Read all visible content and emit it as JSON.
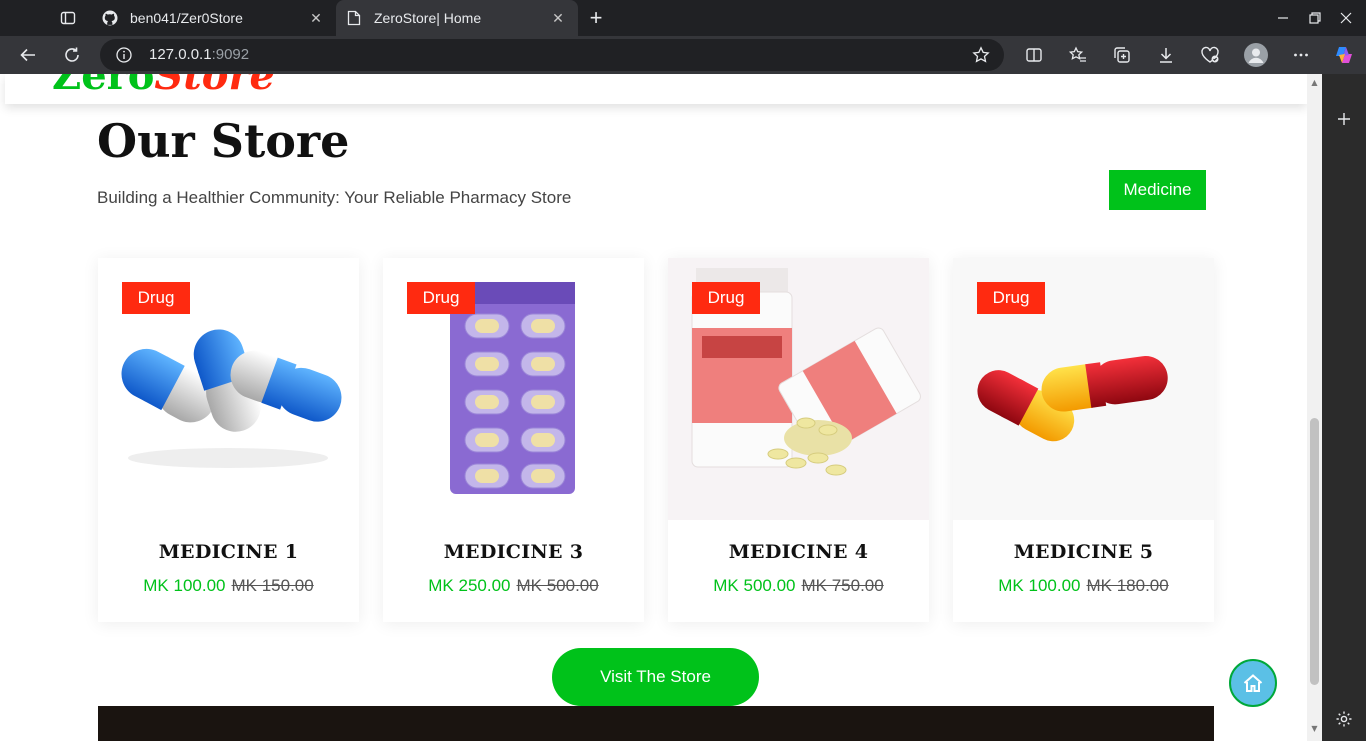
{
  "browser": {
    "tabs": [
      {
        "title": "ben041/Zer0Store",
        "icon": "github-icon"
      },
      {
        "title": "ZeroStore| Home",
        "icon": "page-icon",
        "active": true
      }
    ],
    "address": {
      "host": "127.0.0.1",
      "port": ":9092"
    }
  },
  "site": {
    "logo_part1": "Zero",
    "logo_part2": "Store"
  },
  "store": {
    "title": "Our Store",
    "subtitle": "Building a Healthier Community: Your Reliable Pharmacy Store",
    "filter_label": "Medicine",
    "visit_label": "Visit The Store",
    "products": [
      {
        "tag": "Drug",
        "name": "MEDICINE 1",
        "price": "MK 100.00",
        "old_price": "MK 150.00"
      },
      {
        "tag": "Drug",
        "name": "MEDICINE 3",
        "price": "MK 250.00",
        "old_price": "MK 500.00"
      },
      {
        "tag": "Drug",
        "name": "MEDICINE 4",
        "price": "MK 500.00",
        "old_price": "MK 750.00"
      },
      {
        "tag": "Drug",
        "name": "MEDICINE 5",
        "price": "MK 100.00",
        "old_price": "MK 180.00"
      }
    ]
  },
  "colors": {
    "accent_green": "#00c21a",
    "tag_red": "#ff2a10"
  }
}
